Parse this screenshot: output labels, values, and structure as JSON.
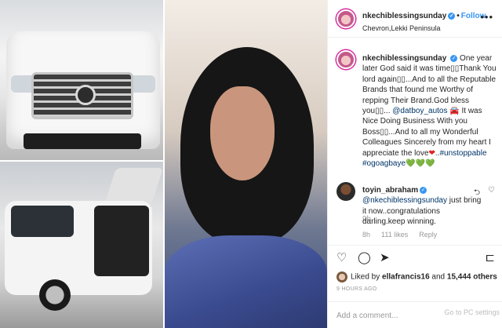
{
  "header": {
    "username": "nkechiblessingsunday",
    "follow_label": "Follow",
    "location": "Chevron,Lekki Peninsula",
    "more_glyph": "•••"
  },
  "caption": {
    "username": "nkechiblessingsunday",
    "text_1": "One year later God said it was time",
    "squares_1": "▯▯",
    "text_2": "Thank You lord again",
    "squares_2": "▯▯",
    "text_3": "...And to all the Reputable Brands that found me Worthy of repping Their Brand.God bless you",
    "squares_3": "▯▯",
    "text_4": "... ",
    "mention": "@datboy_autos",
    "car_glyph": "🚘",
    "text_5": " It was Nice Doing Business With you Boss",
    "squares_5": "▯▯",
    "text_6": "...And to all my Wonderful Colleagues Sincerely from my heart I appreciate the love",
    "heart_glyph": "❤",
    "text_7": "..",
    "hashtag_1": "#unstoppable",
    "hashtag_2": "#ogoagbaye",
    "green_glyphs": "💚💚💚",
    "time": "9h"
  },
  "comment": {
    "username": "toyin_abraham",
    "mention": "@nkechiblessingsunday",
    "text": " just bring it now..congratulations darling.keep winning.",
    "time": "8h",
    "likes": "111 likes",
    "reply": "Reply"
  },
  "actions": {
    "heart_glyph": "♡",
    "comment_glyph": "◯",
    "share_glyph": "➤",
    "save_glyph": "⊏"
  },
  "likes": {
    "prefix": "Liked by ",
    "user": "ellafrancis16",
    "mid": " and ",
    "count": "15,444 others"
  },
  "posted": "9 HOURS AGO",
  "add_comment": {
    "placeholder": "Add a comment..."
  },
  "watermark": "Go to PC settings"
}
